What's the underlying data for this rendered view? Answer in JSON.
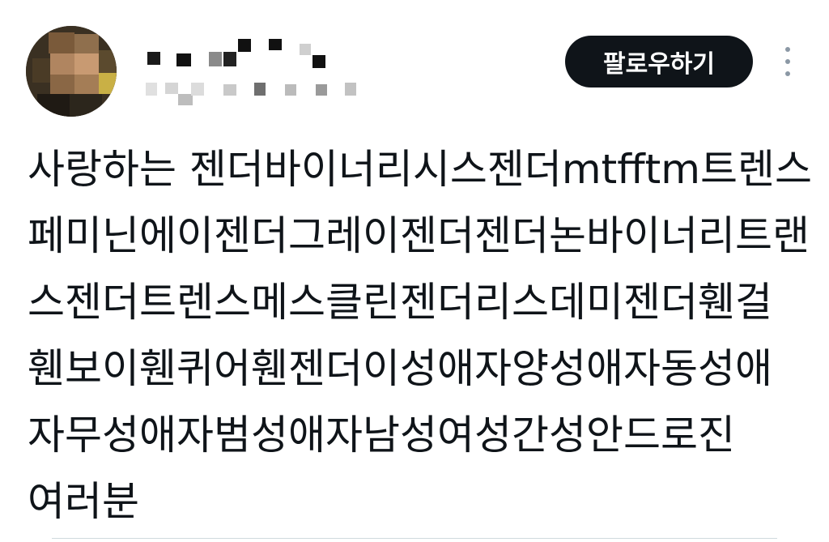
{
  "header": {
    "follow_label": "팔로우하기"
  },
  "post": {
    "lines": [
      "사랑하는 젠더바이너리시스젠더mtfftm트렌스",
      "페미닌에이젠더그레이젠더젠더논바이너리트랜",
      "스젠더트렌스메스클린젠더리스데미젠더휀걸",
      "휀보이휀퀴어휀젠더이성애자양성애자동성애",
      "자무성애자범성애자남성여성간성안드로진",
      "여러분"
    ]
  },
  "icons": {
    "more": "more-vertical-icon"
  },
  "colors": {
    "text": "#0f1419",
    "button_bg": "#0f1419",
    "button_text": "#ffffff",
    "icon_muted": "#8b98a5",
    "divider": "#cfd9de"
  }
}
